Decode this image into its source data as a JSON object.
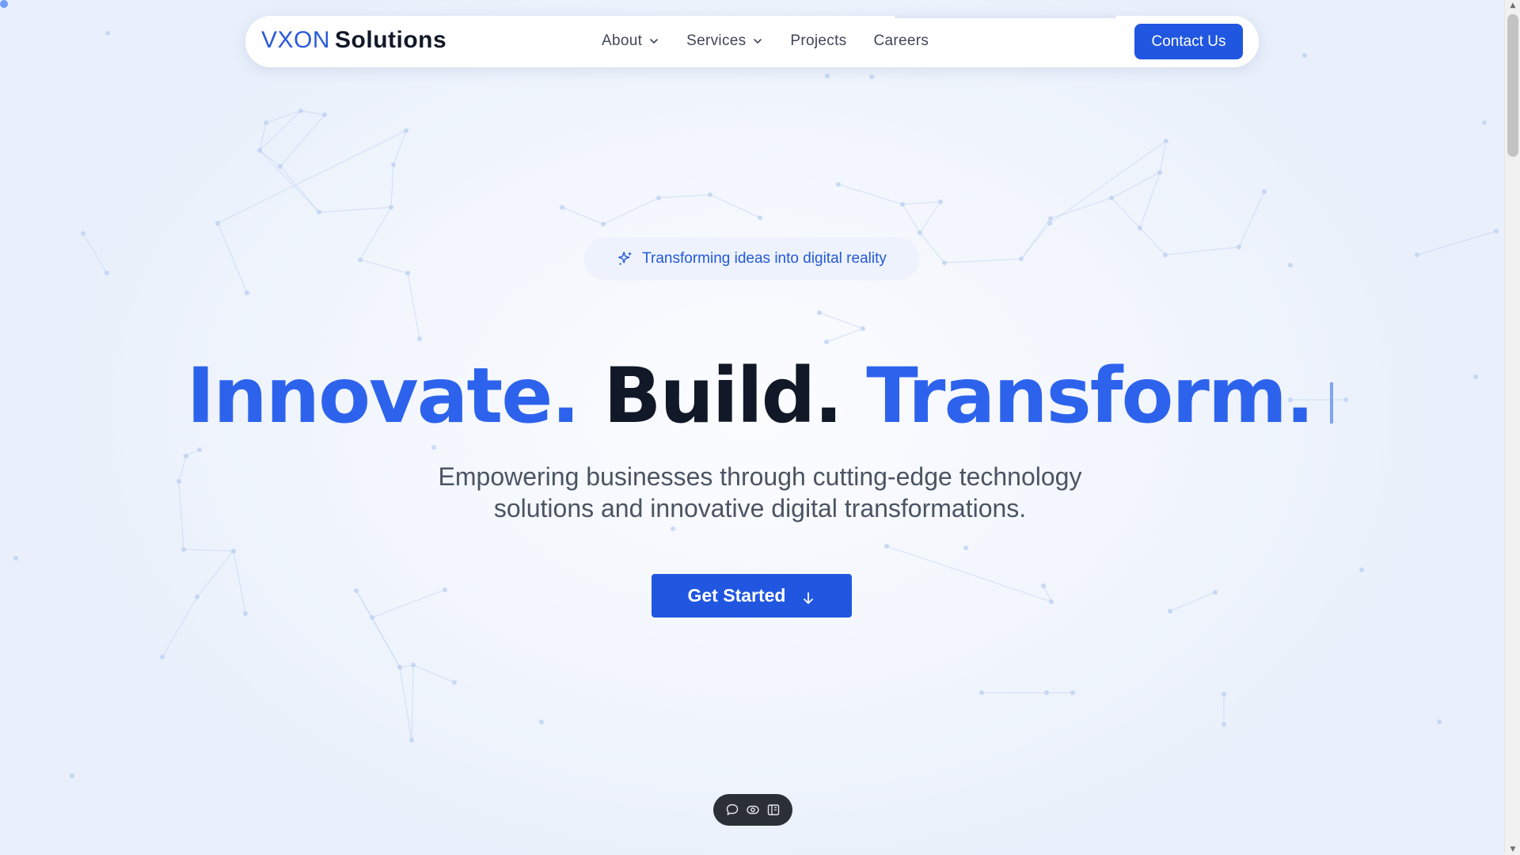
{
  "nav": {
    "logo_brand": "VXON",
    "logo_suffix": "Solutions",
    "items": [
      {
        "label": "About",
        "has_dropdown": true
      },
      {
        "label": "Services",
        "has_dropdown": true
      },
      {
        "label": "Projects",
        "has_dropdown": false
      },
      {
        "label": "Careers",
        "has_dropdown": false
      }
    ],
    "contact_label": "Contact Us"
  },
  "hero": {
    "tagline": "Transforming ideas into digital reality",
    "headline_words": [
      "Innovate.",
      "Build.",
      "Transform."
    ],
    "subtitle_lines": [
      "Empowering businesses through cutting-edge technology",
      "solutions and innovative digital transformations."
    ],
    "cta_label": "Get Started"
  },
  "toolbar": {
    "icons": [
      "comment-icon",
      "eye-icon",
      "sidebar-icon"
    ]
  },
  "colors": {
    "brand_blue": "#2056e0",
    "headline_blue": "#2d63ec",
    "dark": "#111827",
    "network": "#b8cdf0"
  }
}
